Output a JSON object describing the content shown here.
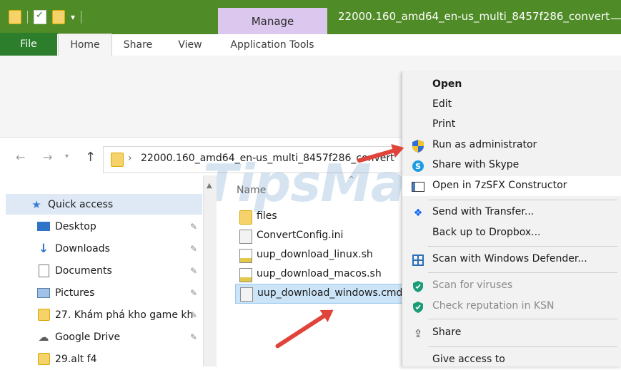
{
  "window": {
    "title": "22000.160_amd64_en-us_multi_8457f286_convert",
    "context_tab": "Manage",
    "minimize_glyph": "—"
  },
  "ribbon": {
    "tabs": [
      "File",
      "Home",
      "Share",
      "View",
      "Application Tools"
    ]
  },
  "address": {
    "path": "22000.160_amd64_en-us_multi_8457f286_convert"
  },
  "nav_pane": {
    "items": [
      {
        "label": "Quick access",
        "icon": "star-icon",
        "pinned": false
      },
      {
        "label": "Desktop",
        "icon": "desktop-icon",
        "pinned": true
      },
      {
        "label": "Downloads",
        "icon": "download-icon",
        "pinned": true
      },
      {
        "label": "Documents",
        "icon": "documents-icon",
        "pinned": true
      },
      {
        "label": "Pictures",
        "icon": "pictures-icon",
        "pinned": true
      },
      {
        "label": "27. Khám phá kho game kh",
        "icon": "folder-icon",
        "pinned": true
      },
      {
        "label": "Google Drive",
        "icon": "cloud-icon",
        "pinned": true
      },
      {
        "label": "29.alt f4",
        "icon": "folder-icon",
        "pinned": false
      }
    ]
  },
  "file_list": {
    "column_header": "Name",
    "files": [
      {
        "name": "files",
        "type": "folder"
      },
      {
        "name": "ConvertConfig.ini",
        "type": "ini"
      },
      {
        "name": "uup_download_linux.sh",
        "type": "sh"
      },
      {
        "name": "uup_download_macos.sh",
        "type": "sh"
      },
      {
        "name": "uup_download_windows.cmd",
        "type": "cmd",
        "selected": true
      }
    ]
  },
  "context_menu": {
    "items": [
      {
        "label": "Open",
        "bold": true,
        "icon": ""
      },
      {
        "label": "Edit",
        "icon": ""
      },
      {
        "label": "Print",
        "icon": ""
      },
      {
        "label": "Run as administrator",
        "icon": "uac-shield-icon"
      },
      {
        "label": "Share with Skype",
        "icon": "skype-icon"
      },
      {
        "label": "Open in 7zSFX Constructor",
        "icon": "sfx-icon",
        "highlighted": true
      },
      {
        "label": "Send with Transfer...",
        "icon": "dropbox-icon"
      },
      {
        "label": "Back up to Dropbox...",
        "icon": ""
      },
      {
        "label": "Scan with Windows Defender...",
        "icon": "defender-icon"
      },
      {
        "label": "Scan for viruses",
        "icon": "kaspersky-icon",
        "disabled": true
      },
      {
        "label": "Check reputation in KSN",
        "icon": "kaspersky-icon",
        "disabled": true
      },
      {
        "label": "Share",
        "icon": "share-icon"
      },
      {
        "label": "Give access to",
        "icon": ""
      }
    ]
  },
  "watermark": "TipsMake",
  "colors": {
    "titlebar": "#4f8b26",
    "manage_tab": "#dcc7ef",
    "file_tab": "#2c7d2c",
    "selection": "#cce4f7",
    "arrow": "#e0433a"
  }
}
